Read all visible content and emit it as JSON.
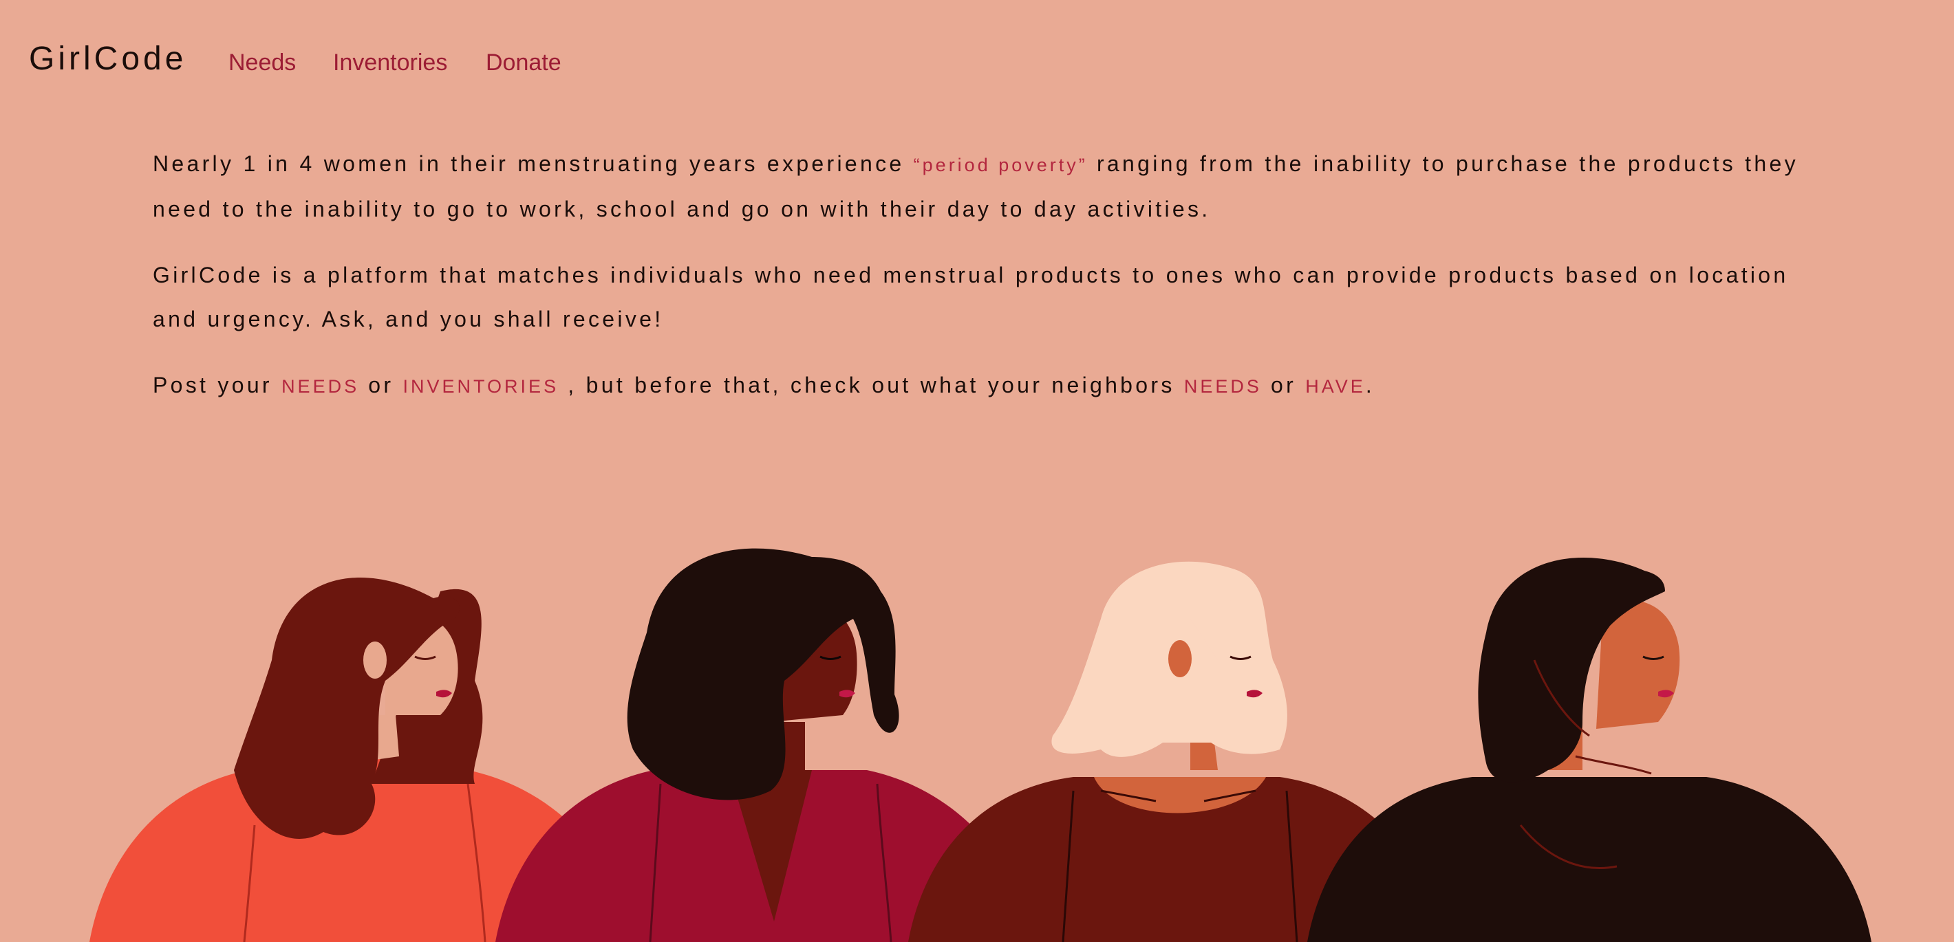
{
  "nav": {
    "brand": "GirlCode",
    "links": [
      "Needs",
      "Inventories",
      "Donate"
    ]
  },
  "intro": {
    "p1_before": "Nearly 1 in 4 women in their menstruating years experience ",
    "p1_highlight": "“period poverty”",
    "p1_after": " ranging from the inability to purchase the products they need to the inability to go to work, school and go on with their day to day activities.",
    "p2": "GirlCode is a platform that matches individuals who need menstrual products to ones who can provide products based on location and urgency. Ask, and you shall receive!",
    "p3_part1": "Post your ",
    "p3_link1": "NEEDS",
    "p3_part2": " or ",
    "p3_link2": "INVENTORIES",
    "p3_part3": " , but before that, check out what your neighbors ",
    "p3_link3": "NEEDS",
    "p3_part4": " or ",
    "p3_link4": "HAVE",
    "p3_end": "."
  },
  "colors": {
    "background": "#e9aa94",
    "accent": "#9c1c34",
    "text": "#1a0d0a"
  }
}
